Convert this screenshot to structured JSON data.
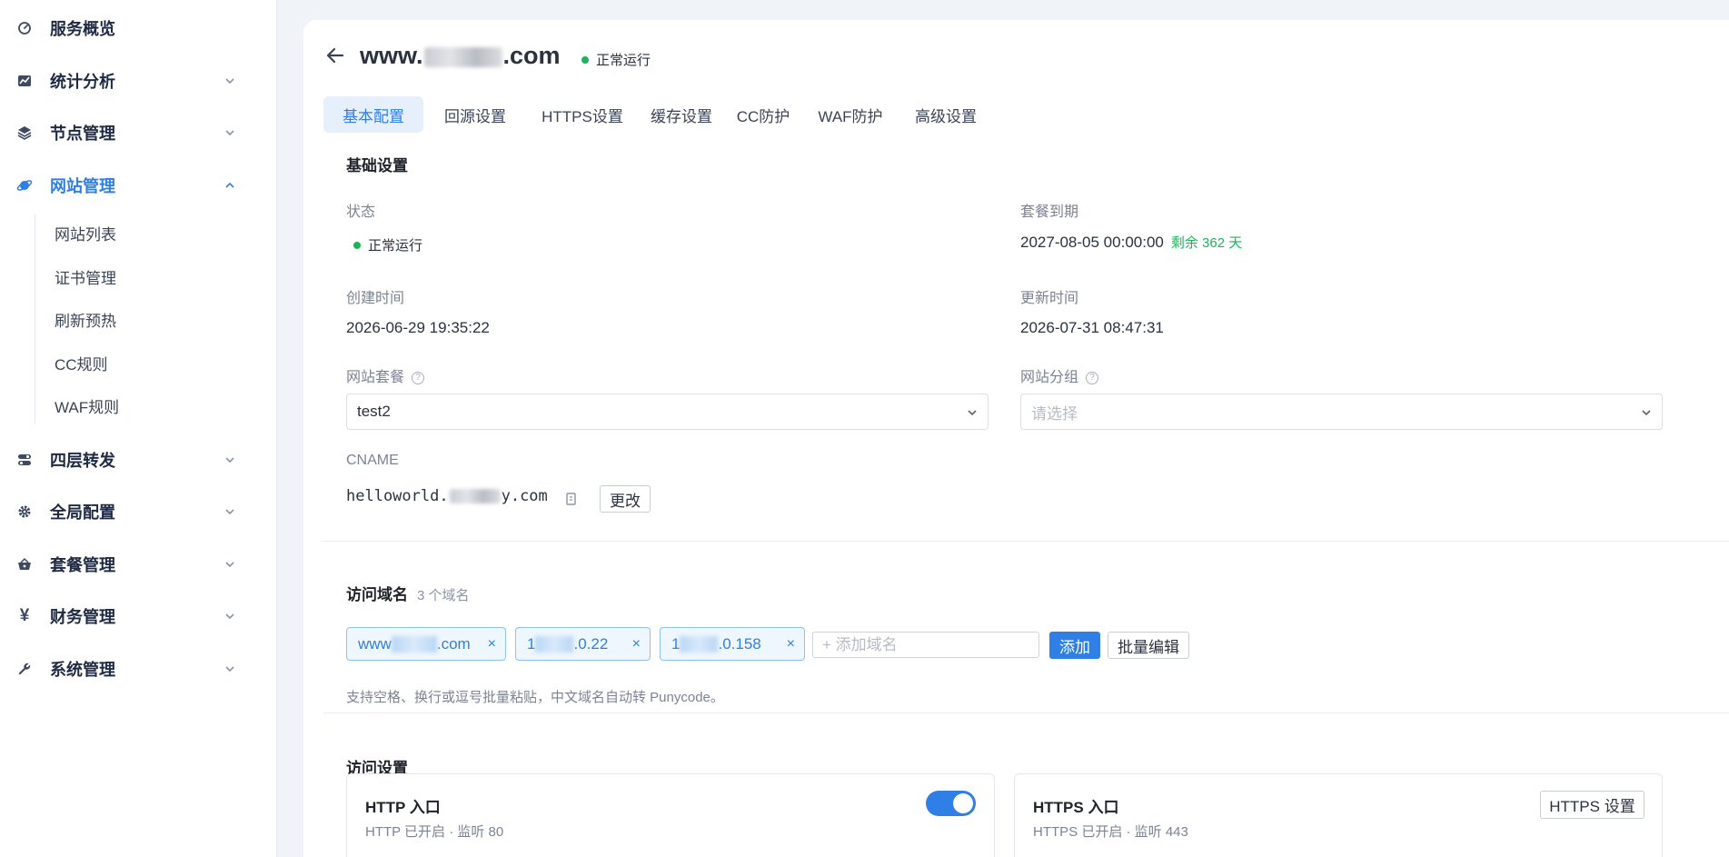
{
  "sidebar": {
    "items": [
      {
        "label": "服务概览",
        "icon": "dashboard-icon"
      },
      {
        "label": "统计分析",
        "icon": "chart-icon"
      },
      {
        "label": "节点管理",
        "icon": "layers-icon"
      },
      {
        "label": "网站管理",
        "icon": "planet-icon",
        "active": true
      },
      {
        "label": "四层转发",
        "icon": "toggles-icon"
      },
      {
        "label": "全局配置",
        "icon": "gear-icon"
      },
      {
        "label": "套餐管理",
        "icon": "basket-icon"
      },
      {
        "label": "财务管理",
        "icon": "yen-icon"
      },
      {
        "label": "系统管理",
        "icon": "wrench-icon"
      }
    ],
    "sub_items": [
      {
        "label": "网站列表"
      },
      {
        "label": "证书管理"
      },
      {
        "label": "刷新预热"
      },
      {
        "label": "CC规则"
      },
      {
        "label": "WAF规则"
      }
    ]
  },
  "header": {
    "title_prefix": "www.",
    "title_suffix": ".com",
    "status": "正常运行"
  },
  "tabs": [
    {
      "label": "基本配置",
      "active": true
    },
    {
      "label": "回源设置"
    },
    {
      "label": "HTTPS设置"
    },
    {
      "label": "缓存设置"
    },
    {
      "label": "CC防护"
    },
    {
      "label": "WAF防护"
    },
    {
      "label": "高级设置"
    }
  ],
  "basic": {
    "section_title": "基础设置",
    "status_label": "状态",
    "status_value": "正常运行",
    "expire_label": "套餐到期",
    "expire_value": "2027-08-05 00:00:00",
    "expire_remaining": "剩余 362 天",
    "created_label": "创建时间",
    "created_value": "2026-06-29 19:35:22",
    "updated_label": "更新时间",
    "updated_value": "2026-07-31 08:47:31",
    "plan_label": "网站套餐",
    "plan_value": "test2",
    "group_label": "网站分组",
    "group_placeholder": "请选择",
    "cname_label": "CNAME",
    "cname_prefix": "helloworld.",
    "cname_suffix": "y.com",
    "change_button": "更改"
  },
  "domains": {
    "section_title": "访问域名",
    "count": "3 个域名",
    "chips": [
      {
        "prefix": "www",
        "suffix": ".com"
      },
      {
        "prefix": "1",
        "suffix": ".0.22"
      },
      {
        "prefix": "1",
        "suffix": ".0.158"
      }
    ],
    "input_placeholder": "+ 添加域名",
    "add_button": "添加",
    "batch_button": "批量编辑",
    "hint": "支持空格、换行或逗号批量粘贴，中文域名自动转 Punycode。"
  },
  "access": {
    "section_title": "访问设置",
    "http": {
      "title": "HTTP 入口",
      "subtitle": "HTTP 已开启 · 监听 80",
      "enabled": true
    },
    "https": {
      "title": "HTTPS 入口",
      "subtitle": "HTTPS 已开启 · 监听 443",
      "settings_button": "HTTPS 设置"
    }
  },
  "colors": {
    "accent": "#2f7fe6",
    "success": "#19b45b",
    "background": "#f0f3f8"
  }
}
